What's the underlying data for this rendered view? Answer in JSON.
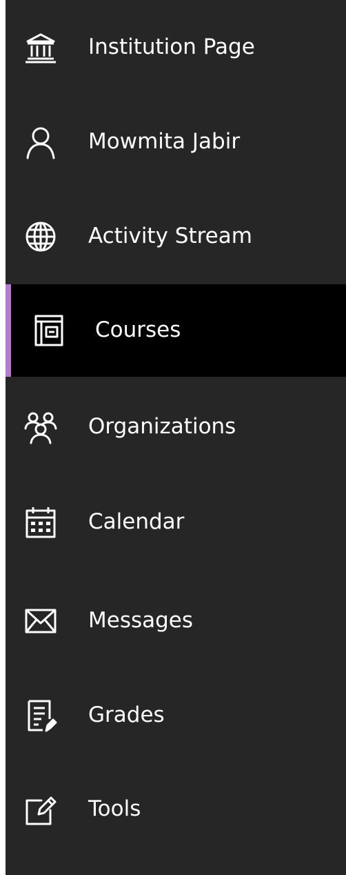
{
  "theme": {
    "background": "#262626",
    "active_background": "#000000",
    "accent": "#b57bd0",
    "text": "#ffffff"
  },
  "nav": {
    "items": [
      {
        "label": "Institution Page",
        "icon": "institution-icon",
        "active": false
      },
      {
        "label": "Mowmita Jabir",
        "icon": "user-icon",
        "active": false
      },
      {
        "label": "Activity Stream",
        "icon": "globe-icon",
        "active": false
      },
      {
        "label": "Courses",
        "icon": "courses-icon",
        "active": true
      },
      {
        "label": "Organizations",
        "icon": "organizations-icon",
        "active": false
      },
      {
        "label": "Calendar",
        "icon": "calendar-icon",
        "active": false
      },
      {
        "label": "Messages",
        "icon": "envelope-icon",
        "active": false
      },
      {
        "label": "Grades",
        "icon": "grades-icon",
        "active": false
      },
      {
        "label": "Tools",
        "icon": "tools-icon",
        "active": false
      }
    ]
  }
}
